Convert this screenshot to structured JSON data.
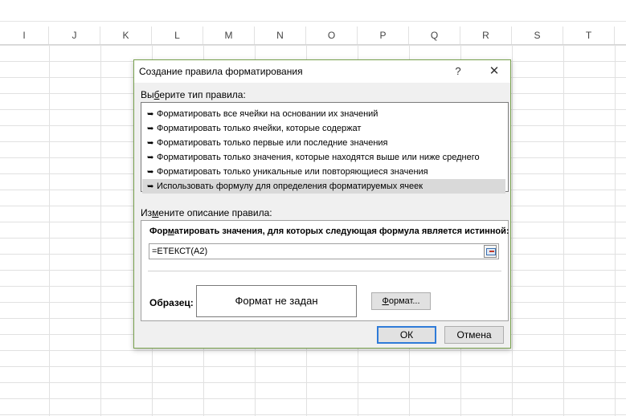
{
  "spreadsheet": {
    "columns": [
      "I",
      "J",
      "K",
      "L",
      "M",
      "N",
      "O",
      "P",
      "Q",
      "R",
      "S",
      "T"
    ]
  },
  "dialog": {
    "title": "Создание правила форматирования",
    "help_label": "?",
    "close_label": "✕",
    "rule_type_label_pre": "Вы",
    "rule_type_label_u": "б",
    "rule_type_label_post": "ерите тип правила:",
    "rule_types": [
      "Форматировать все ячейки на основании их значений",
      "Форматировать только ячейки, которые содержат",
      "Форматировать только первые или последние значения",
      "Форматировать только значения, которые находятся выше или ниже среднего",
      "Форматировать только уникальные или повторяющиеся значения",
      "Использовать формулу для определения форматируемых ячеек"
    ],
    "selected_rule_index": 5,
    "description_label_pre": "Из",
    "description_label_u": "м",
    "description_label_post": "ените описание правила:",
    "formula_caption_pre": "Фор",
    "formula_caption_u": "м",
    "formula_caption_post": "атировать значения, для которых следующая формула является истинной:",
    "formula_value": "=ЕТЕКСТ(A2)",
    "sample_label": "Образец:",
    "preview_text": "Формат не задан",
    "format_button_pre": "",
    "format_button_u": "Ф",
    "format_button_post": "ормат...",
    "ok_label": "ОК",
    "cancel_label": "Отмена"
  },
  "colors": {
    "dialog_border": "#78a14d",
    "ok_border": "#2f7bd8",
    "selected_row": "#d9d9d9"
  }
}
